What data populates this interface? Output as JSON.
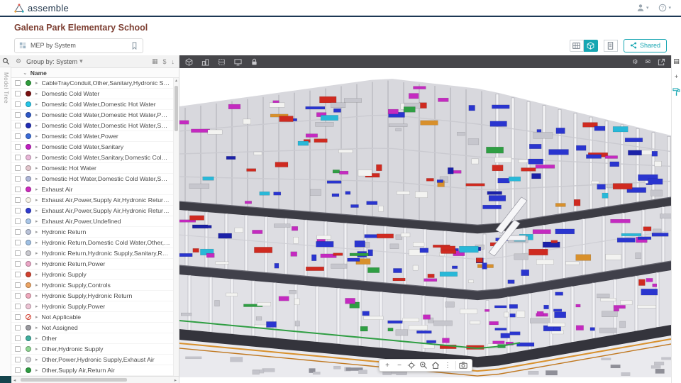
{
  "topbar": {
    "brand": "assemble"
  },
  "header": {
    "title": "Galena Park Elementary School",
    "shared_button": "Shared"
  },
  "view_selector": {
    "value": "MEP by System"
  },
  "left_rail": {
    "model_tree_label": "Model Tree"
  },
  "tree": {
    "toolbar": {
      "group_by": "Group by: System"
    },
    "columns": {
      "name": "Name"
    },
    "rows": [
      {
        "label": "CableTrayConduit,Other,Sanitary,Hydronic Supply,Hydronic Return",
        "color": "#2e9e3c"
      },
      {
        "label": "Domestic Cold Water",
        "color": "#7a1010"
      },
      {
        "label": "Domestic Cold Water,Domestic Hot Water",
        "color": "#25c6e8"
      },
      {
        "label": "Domestic Cold Water,Domestic Hot Water,Power,Sanitary",
        "color": "#2e58c8"
      },
      {
        "label": "Domestic Cold Water,Domestic Hot Water,Sanitary",
        "color": "#1f2bb5"
      },
      {
        "label": "Domestic Cold Water,Power",
        "color": "#3a6bd8"
      },
      {
        "label": "Domestic Cold Water,Sanitary",
        "color": "#c21fc2"
      },
      {
        "label": "Domestic Cold Water,Sanitary,Domestic Cold Water",
        "color": "#e9b6d8"
      },
      {
        "label": "Domestic Hot Water",
        "color": "#e3c6cd"
      },
      {
        "label": "Domestic Hot Water,Domestic Cold Water,Sanitary",
        "color": "#aeb6d8"
      },
      {
        "label": "Exhaust Air",
        "color": "#cf2bbf"
      },
      {
        "label": "Exhaust Air,Power,Supply Air,Hydronic Return,Hydronic Supply",
        "color": "#f7f3e8"
      },
      {
        "label": "Exhaust Air,Power,Supply Air,Hydronic Return,Hydronic Supply",
        "color": "#2f3bd0"
      },
      {
        "label": "Exhaust Air,Power,Undefined",
        "color": "#a9c6e8"
      },
      {
        "label": "Hydronic Return",
        "color": "#b9c2d8"
      },
      {
        "label": "Hydronic Return,Domestic Cold Water,Other,Supply Air,Domestic Hot Water",
        "color": "#9fc0e4"
      },
      {
        "label": "Hydronic Return,Hydronic Supply,Sanitary,Return Air,Power",
        "color": "#c9c9cf"
      },
      {
        "label": "Hydronic Return,Power",
        "color": "#eba6c6"
      },
      {
        "label": "Hydronic Supply",
        "color": "#d2402e"
      },
      {
        "label": "Hydronic Supply,Controls",
        "color": "#eda564"
      },
      {
        "label": "Hydronic Supply,Hydronic Return",
        "color": "#f0a9bd"
      },
      {
        "label": "Hydronic Supply,Power",
        "color": "#ecc3d4"
      },
      {
        "label": "Not Applicable",
        "color": "#ffffff",
        "na": true
      },
      {
        "label": "Not Assigned",
        "color": "#9a9aa0"
      },
      {
        "label": "Other",
        "color": "#3fae9e"
      },
      {
        "label": "Other,Hydronic Supply",
        "color": "#8fd793"
      },
      {
        "label": "Other,Power,Hydronic Supply,Exhaust Air",
        "color": "#d4d4da"
      },
      {
        "label": "Other,Supply Air,Return Air",
        "color": "#2f9e43"
      }
    ]
  },
  "accent": {
    "teal": "#17a6b2",
    "title_brown": "#7e4033",
    "navy": "#1d3854"
  },
  "icons": {
    "gear": "⚙",
    "mail": "✉",
    "caret_down": "▾",
    "sort_down": "⌄",
    "row_caret": "▸",
    "columns": "▦",
    "dollar": "$",
    "export": "↓",
    "plus": "+",
    "minus": "−",
    "kebab": "⋮",
    "scroll_up": "▴",
    "scroll_left": "◂",
    "scroll_right": "▸",
    "panel": "▤",
    "add": "+"
  }
}
